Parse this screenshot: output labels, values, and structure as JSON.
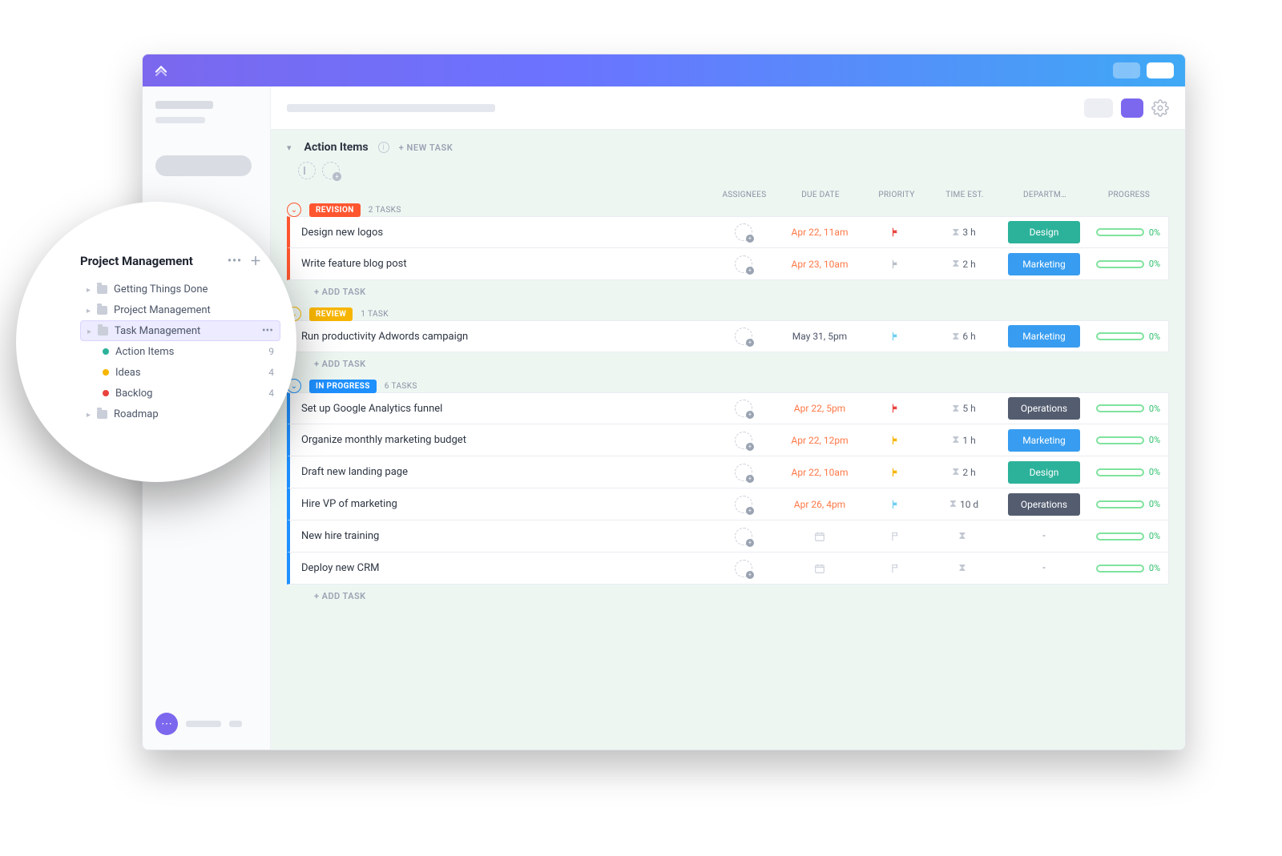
{
  "section": {
    "title": "Action Items",
    "new_task": "+ NEW TASK"
  },
  "columns": [
    "ASSIGNEES",
    "DUE DATE",
    "PRIORITY",
    "TIME EST.",
    "DEPARTM…",
    "PROGRESS"
  ],
  "add_task": "+ ADD TASK",
  "progress_default": "0%",
  "departments": {
    "Design": "#2cb29a",
    "Marketing": "#389df0",
    "Operations": "#545d70"
  },
  "groups": [
    {
      "status": "REVISION",
      "color": "#ff5630",
      "count_label": "2 TASKS",
      "tasks": [
        {
          "title": "Design new logos",
          "due": "Apr 22, 11am",
          "due_color": "#ff7846",
          "flag": "#e9423d",
          "est": "3 h",
          "dept": "Design",
          "progress": "0%"
        },
        {
          "title": "Write feature blog post",
          "due": "Apr 23, 10am",
          "due_color": "#ff7846",
          "flag": "#b9bec9",
          "est": "2 h",
          "dept": "Marketing",
          "progress": "0%"
        }
      ]
    },
    {
      "status": "REVIEW",
      "color": "#f7b500",
      "count_label": "1 TASK",
      "tasks": [
        {
          "title": "Run productivity Adwords campaign",
          "due": "May 31, 5pm",
          "due_color": "#4c5568",
          "flag": "#6fd0f3",
          "est": "6 h",
          "dept": "Marketing",
          "progress": "0%"
        }
      ]
    },
    {
      "status": "IN PROGRESS",
      "color": "#1e90ff",
      "count_label": "6 TASKS",
      "tasks": [
        {
          "title": "Set up Google Analytics funnel",
          "due": "Apr 22, 5pm",
          "due_color": "#ff7846",
          "flag": "#e9423d",
          "est": "5 h",
          "dept": "Operations",
          "progress": "0%"
        },
        {
          "title": "Organize monthly marketing budget",
          "due": "Apr 22, 12pm",
          "due_color": "#ff7846",
          "flag": "#f7b500",
          "est": "1 h",
          "dept": "Marketing",
          "progress": "0%"
        },
        {
          "title": "Draft new landing page",
          "due": "Apr 22, 10am",
          "due_color": "#ff7846",
          "flag": "#f7b500",
          "est": "2 h",
          "dept": "Design",
          "progress": "0%"
        },
        {
          "title": "Hire VP of marketing",
          "due": "Apr 26, 4pm",
          "due_color": "#ff7846",
          "flag": "#6fd0f3",
          "est": "10 d",
          "dept": "Operations",
          "progress": "0%"
        },
        {
          "title": "New hire training",
          "due": "",
          "due_color": "",
          "flag": "",
          "est": "",
          "dept": "",
          "progress": "0%"
        },
        {
          "title": "Deploy new CRM",
          "due": "",
          "due_color": "",
          "flag": "",
          "est": "",
          "dept": "",
          "progress": "0%"
        }
      ]
    }
  ],
  "sidebar_bubble": {
    "space": "Project Management",
    "folders": [
      {
        "name": "Getting Things Done"
      },
      {
        "name": "Project Management"
      },
      {
        "name": "Task Management",
        "active": true,
        "lists": [
          {
            "name": "Action Items",
            "count": "9",
            "dot": "#2cb29a"
          },
          {
            "name": "Ideas",
            "count": "4",
            "dot": "#f7b500"
          },
          {
            "name": "Backlog",
            "count": "4",
            "dot": "#e9423d"
          }
        ]
      },
      {
        "name": "Roadmap"
      }
    ]
  }
}
